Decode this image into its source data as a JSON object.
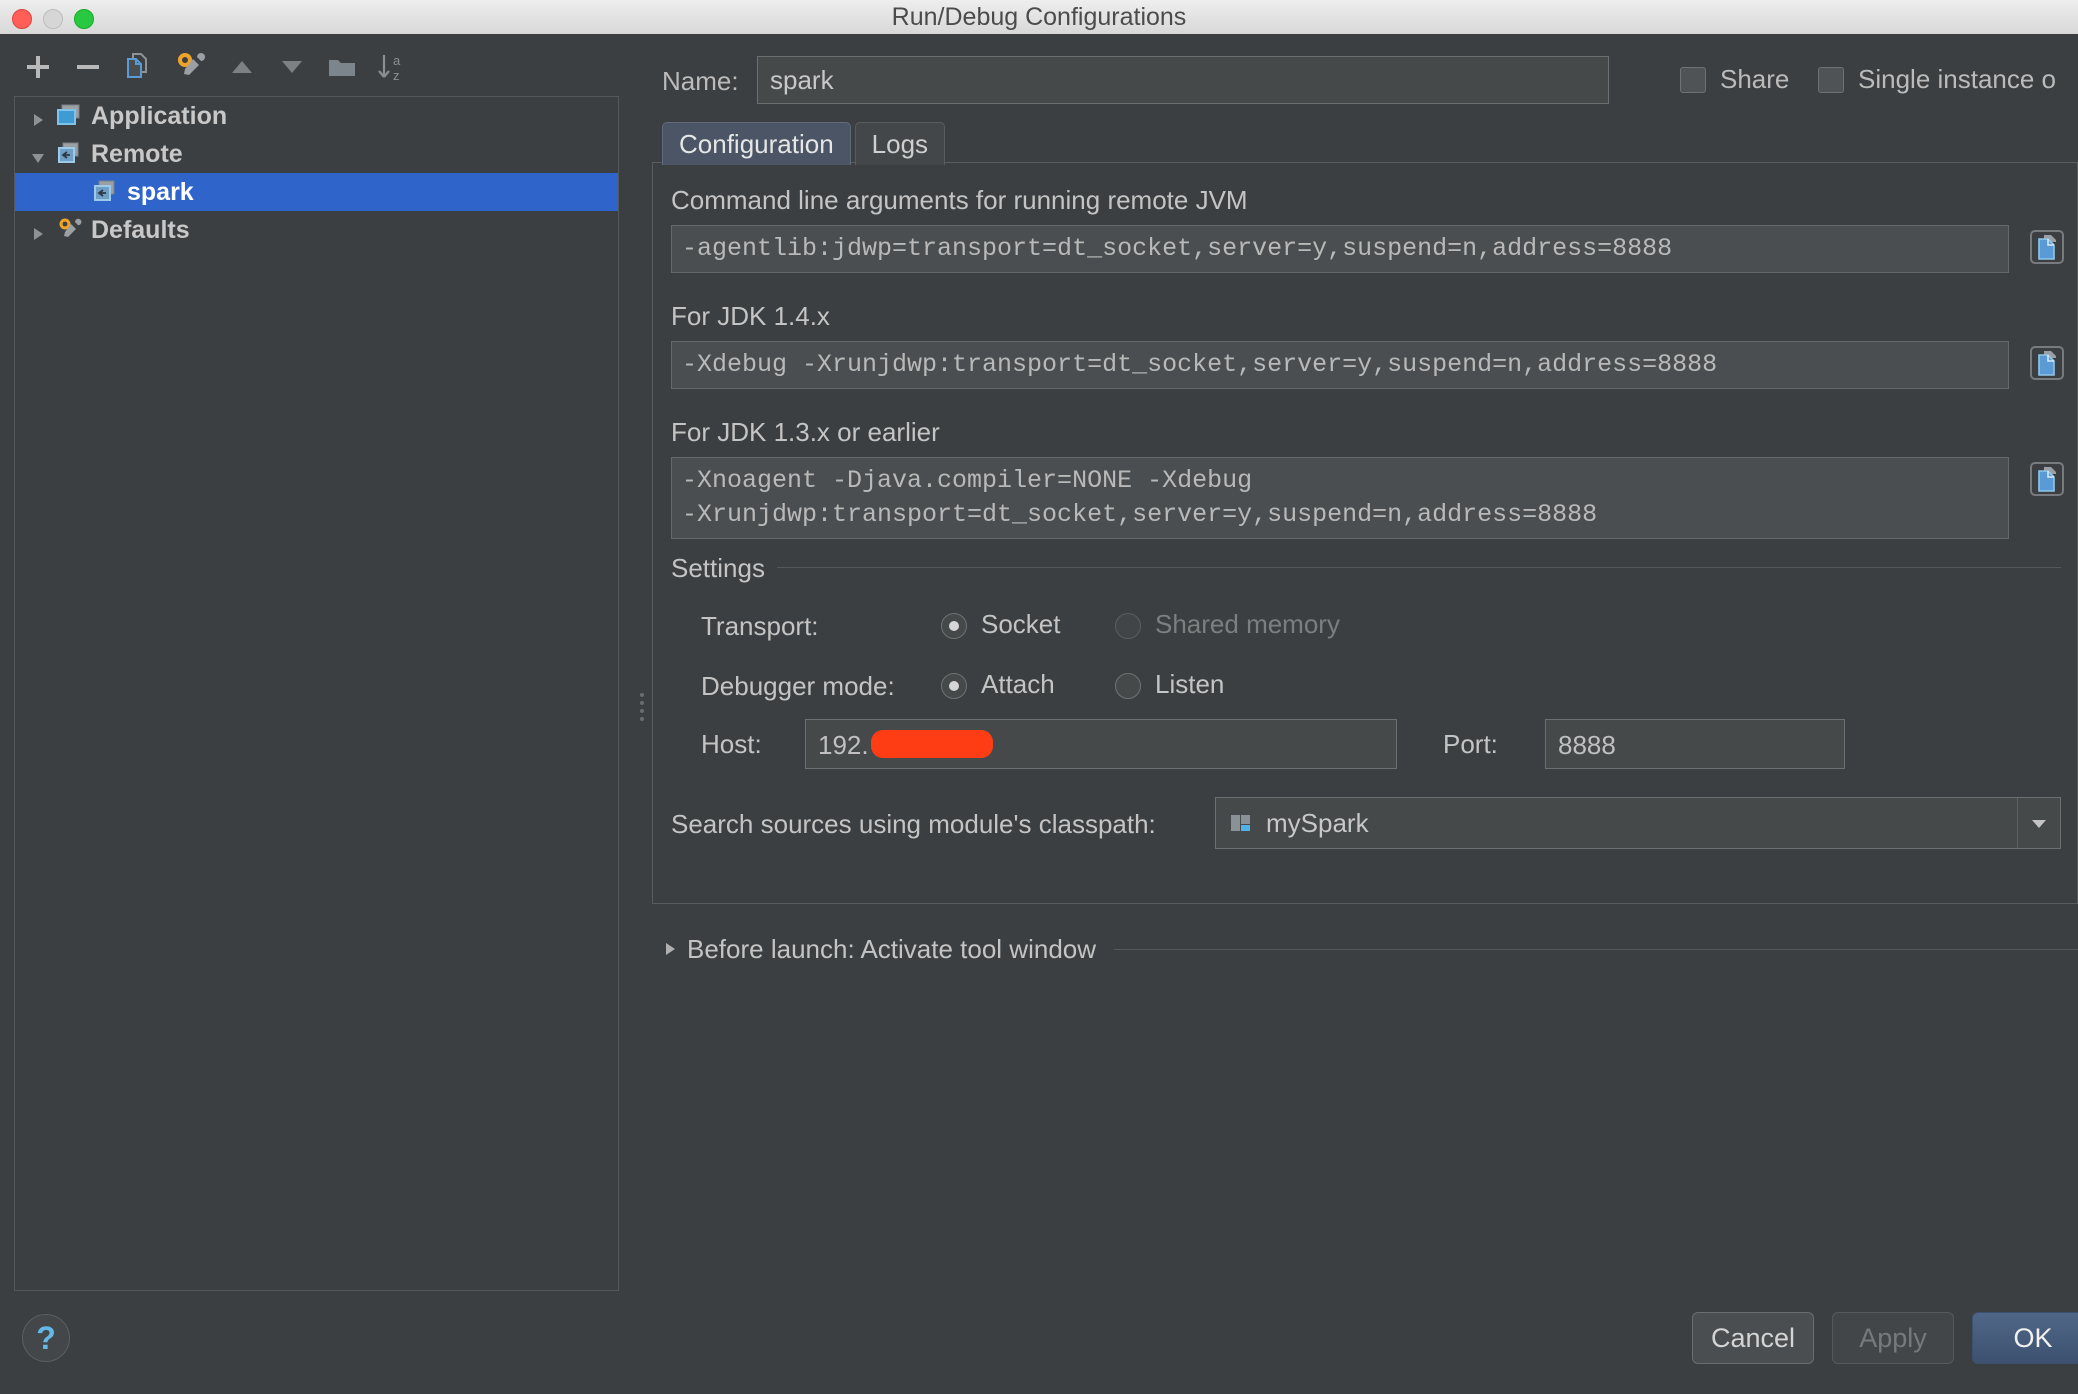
{
  "window": {
    "title": "Run/Debug Configurations",
    "traffic_lights": [
      "close",
      "minimize",
      "zoom"
    ]
  },
  "toolbar": {
    "buttons": [
      {
        "name": "add-configuration-button",
        "icon": "plus-icon",
        "tooltip": "Add New Configuration"
      },
      {
        "name": "remove-configuration-button",
        "icon": "minus-icon",
        "tooltip": "Remove Configuration"
      },
      {
        "name": "copy-configuration-button",
        "icon": "copy-pages-icon",
        "tooltip": "Copy Configuration"
      },
      {
        "name": "edit-defaults-button",
        "icon": "wrench-gear-icon",
        "tooltip": "Edit Defaults"
      },
      {
        "name": "move-up-button",
        "icon": "triangle-up-icon",
        "tooltip": "Move Up"
      },
      {
        "name": "move-down-button",
        "icon": "triangle-down-icon",
        "tooltip": "Move Down"
      },
      {
        "name": "new-folder-button",
        "icon": "folder-icon",
        "tooltip": "Create New Folder"
      },
      {
        "name": "sort-button",
        "icon": "sort-az-icon",
        "tooltip": "Sort Configurations"
      }
    ]
  },
  "tree": {
    "items": [
      {
        "label": "Application",
        "icon": "application-icon",
        "twisty": "collapsed",
        "level": 0,
        "selected": false
      },
      {
        "label": "Remote",
        "icon": "remote-icon",
        "twisty": "expanded",
        "level": 0,
        "selected": false
      },
      {
        "label": "spark",
        "icon": "remote-icon",
        "twisty": "none",
        "level": 1,
        "selected": true
      },
      {
        "label": "Defaults",
        "icon": "wrench-gear-icon",
        "twisty": "collapsed",
        "level": 0,
        "selected": false
      }
    ]
  },
  "form": {
    "name_label": "Name:",
    "name_value": "spark",
    "share": {
      "label_prefix": "",
      "label": "Share",
      "mnemonic": "S",
      "checked": false
    },
    "single_instance": {
      "label": "Single instance o",
      "mnemonic": "i",
      "checked": false
    }
  },
  "tabs": [
    {
      "label": "Configuration",
      "active": true
    },
    {
      "label": "Logs",
      "active": false
    }
  ],
  "configuration": {
    "cmdline_label": "Command line arguments for running remote JVM",
    "cmdline_value": "-agentlib:jdwp=transport=dt_socket,server=y,suspend=n,address=8888",
    "jdk14_label": "For JDK 1.4.x",
    "jdk14_value": "-Xdebug -Xrunjdwp:transport=dt_socket,server=y,suspend=n,address=8888",
    "jdk13_label": "For JDK 1.3.x or earlier",
    "jdk13_value": "-Xnoagent -Djava.compiler=NONE -Xdebug\n-Xrunjdwp:transport=dt_socket,server=y,suspend=n,address=8888",
    "copy_icon_name": "copy-to-clipboard-icon",
    "settings_group": "Settings",
    "transport_label": "Transport:",
    "transport_options": [
      {
        "label": "Socket",
        "selected": true,
        "disabled": false
      },
      {
        "label": "Shared memory",
        "selected": false,
        "disabled": true
      }
    ],
    "debugger_mode_label": "Debugger mode:",
    "debugger_mode_options": [
      {
        "label": "Attach",
        "selected": true,
        "disabled": false
      },
      {
        "label": "Listen",
        "selected": false,
        "disabled": false
      }
    ],
    "host_label": "Host:",
    "host_value": "192.",
    "host_redacted": true,
    "port_label": "Port:",
    "port_value": "8888",
    "classpath_label": "Search sources using module's classpath:",
    "classpath_value": "mySpark",
    "classpath_icon": "module-icon",
    "dropdown_icon": "chevron-down-icon"
  },
  "before_launch": {
    "label": "Before launch: Activate tool window",
    "twisty": "collapsed"
  },
  "footer": {
    "help_label": "?",
    "cancel_label": "Cancel",
    "apply_label": "Apply",
    "apply_disabled": true,
    "ok_label": "OK"
  },
  "colors": {
    "window_bg": "#3c3f41",
    "selection_blue": "#2f65ca",
    "accent_blue": "#63b8e8",
    "redaction_red": "#ff3d14",
    "title_bar": "#e6e6e6"
  }
}
